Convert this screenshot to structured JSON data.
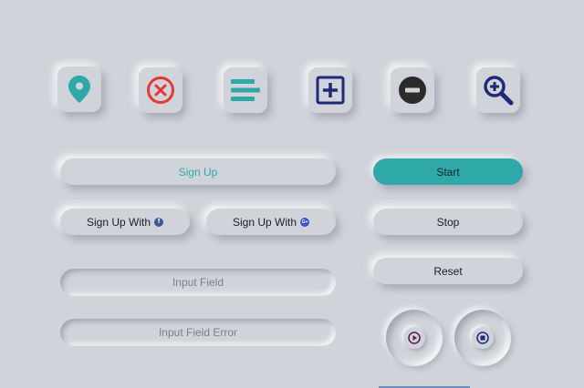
{
  "icons": [
    "location-pin-icon",
    "close-circle-icon",
    "align-left-icon",
    "plus-square-icon",
    "minus-circle-icon",
    "zoom-in-icon"
  ],
  "colors": {
    "background": "#d1d3da",
    "teal": "#2fa8a8",
    "red": "#e53935",
    "navy": "#1e2a78",
    "dark": "#2b2b2b",
    "facebook": "#3b5998",
    "google_plus": "#3b4fcf",
    "play_icon": "#5a1a4a"
  },
  "buttons": {
    "sign_up": "Sign Up",
    "sign_up_with_facebook": "Sign Up With",
    "sign_up_with_google_plus": "Sign Up With",
    "start": "Start",
    "stop": "Stop",
    "reset": "Reset"
  },
  "social": {
    "facebook_glyph": "f",
    "google_plus_glyph": "G+"
  },
  "inputs": {
    "input_field_placeholder": "Input Field",
    "input_field_error_placeholder": "Input Field Error"
  },
  "media": [
    "play-icon",
    "stop-icon"
  ]
}
